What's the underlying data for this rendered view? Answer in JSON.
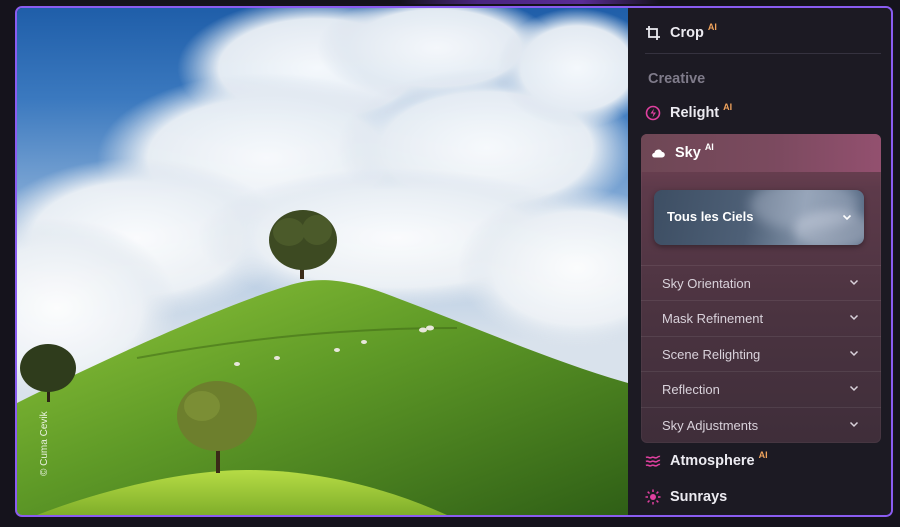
{
  "photo": {
    "credit": "© Cuma Cevik"
  },
  "panel": {
    "crop": {
      "label": "Crop",
      "badge": "AI"
    },
    "section_title": "Creative",
    "relight": {
      "label": "Relight",
      "badge": "AI"
    },
    "sky": {
      "label": "Sky",
      "badge": "AI",
      "preset": {
        "label": "Tous les Ciels"
      },
      "subsections": [
        {
          "label": "Sky Orientation"
        },
        {
          "label": "Mask Refinement"
        },
        {
          "label": "Scene Relighting"
        },
        {
          "label": "Reflection"
        },
        {
          "label": "Sky Adjustments"
        }
      ]
    },
    "atmosphere": {
      "label": "Atmosphere",
      "badge": "AI"
    },
    "sunrays": {
      "label": "Sunrays"
    }
  },
  "colors": {
    "accent_border": "#8a5cf0",
    "ai_badge": "#f0a35c",
    "icon_pink": "#e040a0"
  }
}
